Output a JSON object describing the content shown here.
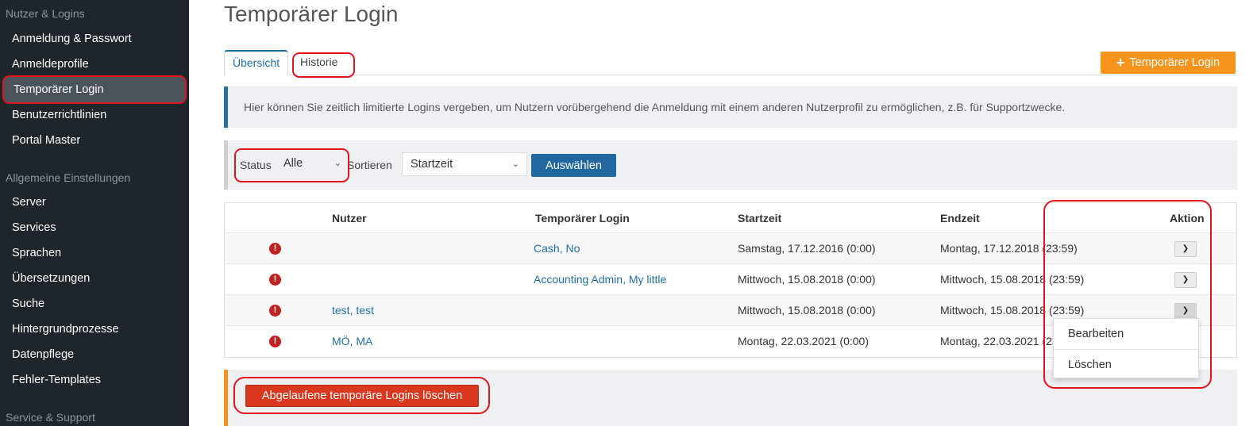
{
  "sidebar": {
    "sections": [
      {
        "title": "Nutzer & Logins",
        "items": [
          {
            "label": "Anmeldung & Passwort"
          },
          {
            "label": "Anmeldeprofile"
          },
          {
            "label": "Temporärer Login",
            "active": true
          },
          {
            "label": "Benutzerrichtlinien"
          },
          {
            "label": "Portal Master"
          }
        ]
      },
      {
        "title": "Allgemeine Einstellungen",
        "items": [
          {
            "label": "Server"
          },
          {
            "label": "Services"
          },
          {
            "label": "Sprachen"
          },
          {
            "label": "Übersetzungen"
          },
          {
            "label": "Suche"
          },
          {
            "label": "Hintergrundprozesse"
          },
          {
            "label": "Datenpflege"
          },
          {
            "label": "Fehler-Templates"
          }
        ]
      },
      {
        "title": "Service & Support",
        "items": []
      }
    ]
  },
  "page": {
    "title": "Temporärer Login"
  },
  "tabs": [
    {
      "label": "Übersicht",
      "active": true
    },
    {
      "label": "Historie",
      "active": false
    }
  ],
  "add_button": {
    "icon": "plus-icon",
    "label": "Temporärer Login"
  },
  "info_text": "Hier können Sie zeitlich limitierte Logins vergeben, um Nutzern vorübergehend die Anmeldung mit einem anderen Nutzerprofil zu ermöglichen, z.B. für Supportzwecke.",
  "filter": {
    "status_label": "Status",
    "status_value": "Alle",
    "sort_label": "Sortieren",
    "sort_value": "Startzeit",
    "submit_label": "Auswählen"
  },
  "table": {
    "columns": [
      "Nutzer",
      "Temporärer Login",
      "Startzeit",
      "Endzeit",
      "Aktion"
    ],
    "rows": [
      {
        "user": "",
        "temp_login": "Cash, No",
        "start": "Samstag, 17.12.2016 (0:00)",
        "end": "Montag, 17.12.2018 (23:59)"
      },
      {
        "user": "",
        "temp_login": "Accounting Admin, My little",
        "start": "Mittwoch, 15.08.2018 (0:00)",
        "end": "Mittwoch, 15.08.2018 (23:59)"
      },
      {
        "user": "test, test",
        "temp_login": "",
        "start": "Mittwoch, 15.08.2018 (0:00)",
        "end": "Mittwoch, 15.08.2018 (23:59)"
      },
      {
        "user": "MÖ, MA",
        "temp_login": "",
        "start": "Montag, 22.03.2021 (0:00)",
        "end": "Montag, 22.03.2021 (23:59)"
      }
    ]
  },
  "action_menu": {
    "items": [
      "Bearbeiten",
      "Löschen"
    ]
  },
  "delete_expired_button": "Abgelaufene temporäre Logins löschen",
  "colors": {
    "sidebar_bg": "#1e252b",
    "accent_orange": "#f7941d",
    "primary_blue": "#2168a0",
    "danger_red": "#d9381e",
    "annotation_red": "#e3141c"
  }
}
